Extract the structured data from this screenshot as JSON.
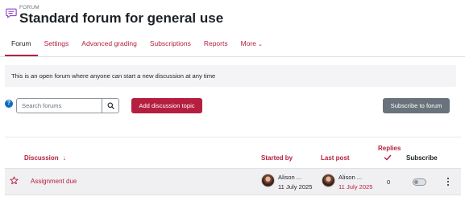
{
  "header": {
    "kicker": "FORUM",
    "title": "Standard forum for general use",
    "icon": "forum-icon",
    "accent": "#b51f3f"
  },
  "tabs": [
    {
      "label": "Forum",
      "active": true
    },
    {
      "label": "Settings",
      "active": false
    },
    {
      "label": "Advanced grading",
      "active": false
    },
    {
      "label": "Subscriptions",
      "active": false
    },
    {
      "label": "Reports",
      "active": false
    },
    {
      "label": "More",
      "active": false
    }
  ],
  "info": {
    "text": "This is an open forum where anyone can start a new discussion at any time"
  },
  "search": {
    "placeholder": "Search forums",
    "value": ""
  },
  "buttons": {
    "add_discussion": "Add discussion topic",
    "subscribe_forum": "Subscribe to forum"
  },
  "table": {
    "headers": {
      "discussion": "Discussion",
      "discussion_sort": "↓",
      "started_by": "Started by",
      "last_post": "Last post",
      "replies": "Replies",
      "subscribe": "Subscribe"
    },
    "rows": [
      {
        "title": "Assignment due",
        "starred": false,
        "started_by": {
          "name": "Alison ...",
          "date": "11 July 2025"
        },
        "last_post": {
          "name": "Alison ...",
          "date": "11 July 2025"
        },
        "replies": "0",
        "subscribed": false
      }
    ]
  }
}
